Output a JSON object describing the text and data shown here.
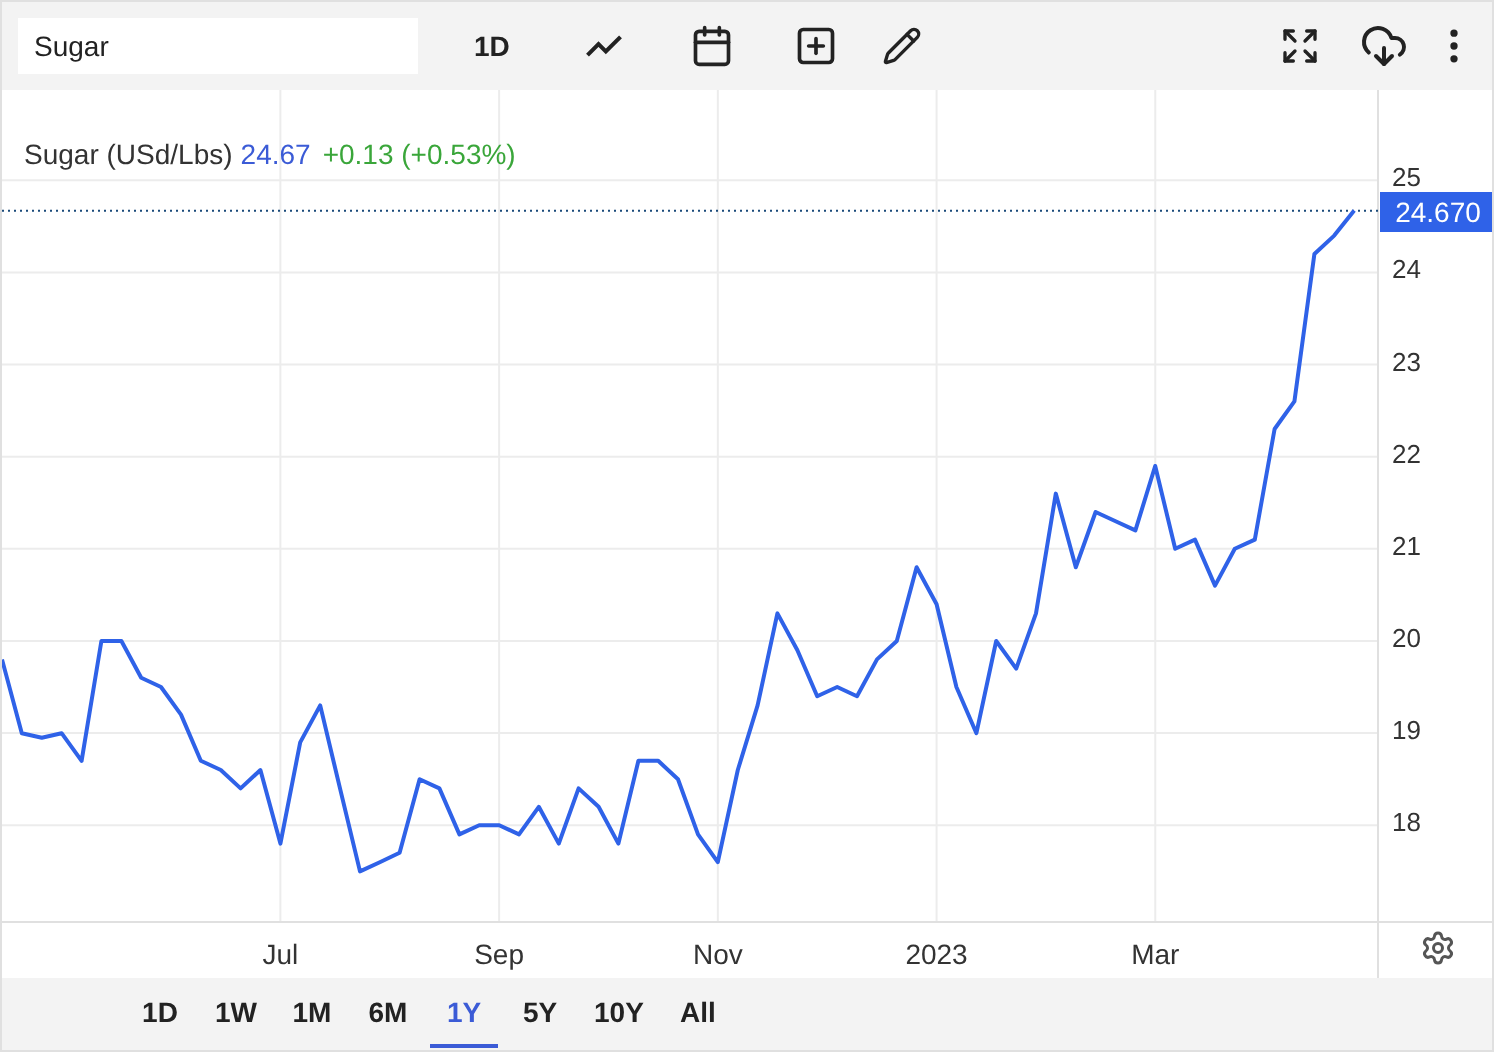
{
  "search": {
    "value": "Sugar"
  },
  "toolbar": {
    "interval": "1D"
  },
  "legend": {
    "price": "24.67",
    "change": "+0.13 (+0.53%)"
  },
  "chart_data": {
    "type": "line",
    "grid": true,
    "ylim": [
      16.95,
      25.98
    ],
    "categories": [
      null,
      null,
      null,
      null,
      null,
      null,
      null,
      null,
      null,
      null,
      null,
      null,
      null,
      null,
      "Jul",
      null,
      null,
      null,
      null,
      null,
      null,
      null,
      null,
      null,
      null,
      "Sep",
      null,
      null,
      null,
      null,
      null,
      null,
      null,
      null,
      null,
      null,
      "Nov",
      null,
      null,
      null,
      null,
      null,
      null,
      null,
      null,
      null,
      null,
      "2023",
      null,
      null,
      null,
      null,
      null,
      null,
      null,
      null,
      null,
      null,
      "Mar",
      null,
      null,
      null,
      null,
      null,
      null,
      null,
      null,
      null,
      null
    ],
    "ref_lines": [
      {
        "axis": "y",
        "value": 24.67,
        "label": "24.670"
      }
    ],
    "yticks": [
      18,
      19,
      20,
      21,
      22,
      23,
      24,
      25
    ],
    "series": [
      {
        "name": "Sugar (USd/Lbs)",
        "color": "#2f62e8",
        "values": [
          19.8,
          19.0,
          18.95,
          19.0,
          18.7,
          20.0,
          20.0,
          19.6,
          19.5,
          19.2,
          18.7,
          18.6,
          18.4,
          18.6,
          17.8,
          18.9,
          19.3,
          18.4,
          17.5,
          17.6,
          17.7,
          18.5,
          18.4,
          17.9,
          18.0,
          18.0,
          17.9,
          18.2,
          17.8,
          18.4,
          18.2,
          17.8,
          18.7,
          18.7,
          18.5,
          17.9,
          17.6,
          18.6,
          19.3,
          20.3,
          19.9,
          19.4,
          19.5,
          19.4,
          19.8,
          20.0,
          20.8,
          20.4,
          19.5,
          19.0,
          20.0,
          19.7,
          20.3,
          21.6,
          20.8,
          21.4,
          21.3,
          21.2,
          21.9,
          21.0,
          21.1,
          20.6,
          21.0,
          21.1,
          22.3,
          22.6,
          24.2,
          24.4,
          24.67
        ]
      }
    ]
  },
  "ranges": [
    {
      "label": "1D",
      "selected": false
    },
    {
      "label": "1W",
      "selected": false
    },
    {
      "label": "1M",
      "selected": false
    },
    {
      "label": "6M",
      "selected": false
    },
    {
      "label": "1Y",
      "selected": true
    },
    {
      "label": "5Y",
      "selected": false
    },
    {
      "label": "10Y",
      "selected": false
    },
    {
      "label": "All",
      "selected": false
    }
  ]
}
